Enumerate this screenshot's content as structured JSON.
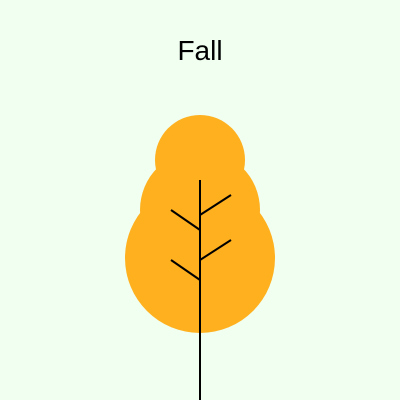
{
  "title": "Fall",
  "colors": {
    "background": "#f0fff0",
    "foliage": "#ffb01f",
    "trunk": "#000000"
  },
  "icons": {
    "tree": "deciduous-tree-icon"
  }
}
